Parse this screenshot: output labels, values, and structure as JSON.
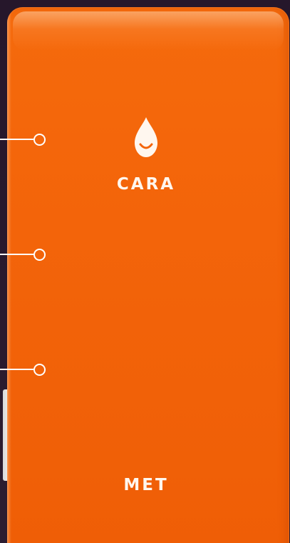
{
  "device": {
    "brand_label": "CARA",
    "bottom_label": "MET",
    "logo_icon": "water-drop-smile-icon",
    "body_color": "#F36408",
    "text_color": "#FFF7EF"
  },
  "callouts": [
    {
      "name": "callout-marker-1",
      "icon": "circle-dot-icon"
    },
    {
      "name": "callout-marker-2",
      "icon": "circle-dot-icon"
    },
    {
      "name": "callout-marker-3",
      "icon": "circle-dot-icon"
    }
  ],
  "background_color": "#26172B"
}
